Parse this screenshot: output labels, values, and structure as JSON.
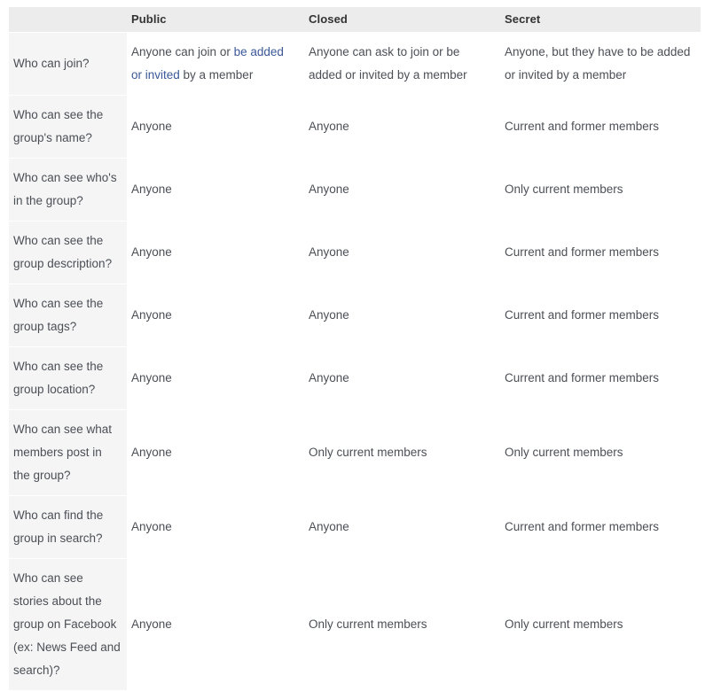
{
  "table": {
    "columns": [
      {
        "key": "label",
        "header": ""
      },
      {
        "key": "public",
        "header": "Public"
      },
      {
        "key": "closed",
        "header": "Closed"
      },
      {
        "key": "secret",
        "header": "Secret"
      }
    ],
    "link_color": "#3b5998",
    "text_color": "#4b4f56",
    "header_bg": "#ececec",
    "rowhead_bg": "#f5f5f5",
    "rows": [
      {
        "label": "Who can join?",
        "public_parts": [
          {
            "text": "Anyone can join or ",
            "link": false
          },
          {
            "text": "be added or invited",
            "link": true
          },
          {
            "text": " by a member",
            "link": false
          }
        ],
        "public": "Anyone can join or be added or invited by a member",
        "closed": "Anyone can ask to join or be added or invited by a member",
        "secret": "Anyone, but they have to be added or invited by a member"
      },
      {
        "label": "Who can see the group's name?",
        "public": "Anyone",
        "closed": "Anyone",
        "secret": "Current and former members"
      },
      {
        "label": "Who can see who's in the group?",
        "public": "Anyone",
        "closed": "Anyone",
        "secret": "Only current members"
      },
      {
        "label": "Who can see the group description?",
        "public": "Anyone",
        "closed": "Anyone",
        "secret": "Current and former members"
      },
      {
        "label": "Who can see the group tags?",
        "public": "Anyone",
        "closed": "Anyone",
        "secret": "Current and former members"
      },
      {
        "label": "Who can see the group location?",
        "public": "Anyone",
        "closed": "Anyone",
        "secret": "Current and former members"
      },
      {
        "label": "Who can see what members post in the group?",
        "public": "Anyone",
        "closed": "Only current members",
        "secret": "Only current members"
      },
      {
        "label": "Who can find the group in search?",
        "public": "Anyone",
        "closed": "Anyone",
        "secret": "Current and former members"
      },
      {
        "label": "Who can see stories about the group on Facebook (ex: News Feed and search)?",
        "public": "Anyone",
        "closed": "Only current members",
        "secret": "Only current members"
      }
    ]
  }
}
